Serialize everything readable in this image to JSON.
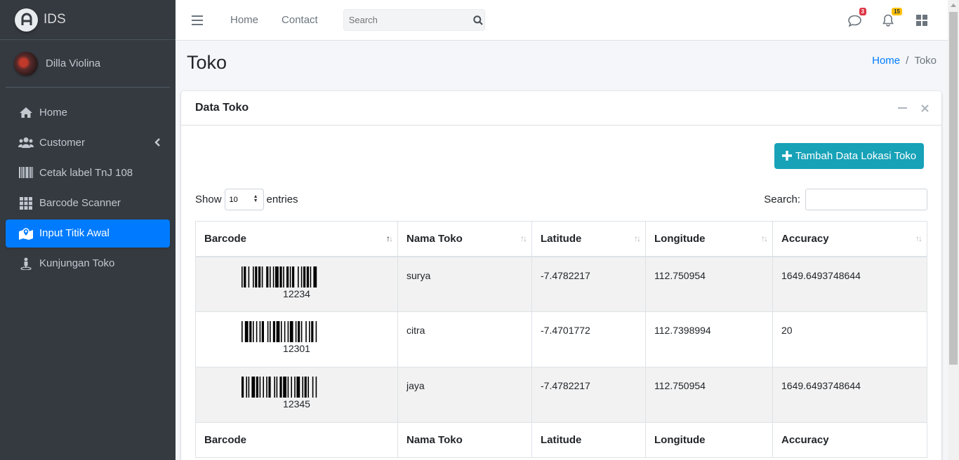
{
  "brand": {
    "name": "IDS"
  },
  "user": {
    "name": "Dilla Violina"
  },
  "sidebar": {
    "items": [
      {
        "label": "Home",
        "icon": "home-icon"
      },
      {
        "label": "Customer",
        "icon": "users-icon"
      },
      {
        "label": "Cetak label TnJ 108",
        "icon": "barcode-icon"
      },
      {
        "label": "Barcode Scanner",
        "icon": "grid-icon"
      },
      {
        "label": "Input Titik Awal",
        "icon": "map-marker-icon",
        "active": true
      },
      {
        "label": "Kunjungan Toko",
        "icon": "person-pin-icon"
      }
    ]
  },
  "topbar": {
    "links": [
      "Home",
      "Contact"
    ],
    "search_placeholder": "Search",
    "messages_badge": "3",
    "notifications_badge": "15"
  },
  "page": {
    "title": "Toko"
  },
  "breadcrumb": {
    "home": "Home",
    "sep": "/",
    "current": "Toko"
  },
  "card": {
    "title": "Data Toko",
    "add_button": "Tambah Data Lokasi Toko",
    "length": {
      "show": "Show",
      "value": "10",
      "entries": "entries"
    },
    "search_label": "Search:"
  },
  "table": {
    "columns": [
      "Barcode",
      "Nama Toko",
      "Latitude",
      "Longitude",
      "Accuracy"
    ],
    "rows": [
      {
        "barcode": "12234",
        "nama": "surya",
        "lat": "-7.4782217",
        "lng": "112.750954",
        "acc": "1649.6493748644"
      },
      {
        "barcode": "12301",
        "nama": "citra",
        "lat": "-7.4701772",
        "lng": "112.7398994",
        "acc": "20"
      },
      {
        "barcode": "12345",
        "nama": "jaya",
        "lat": "-7.4782217",
        "lng": "112.750954",
        "acc": "1649.6493748644"
      }
    ]
  },
  "colors": {
    "primary": "#007bff",
    "info": "#17a2b8",
    "sidebar": "#343a40"
  }
}
